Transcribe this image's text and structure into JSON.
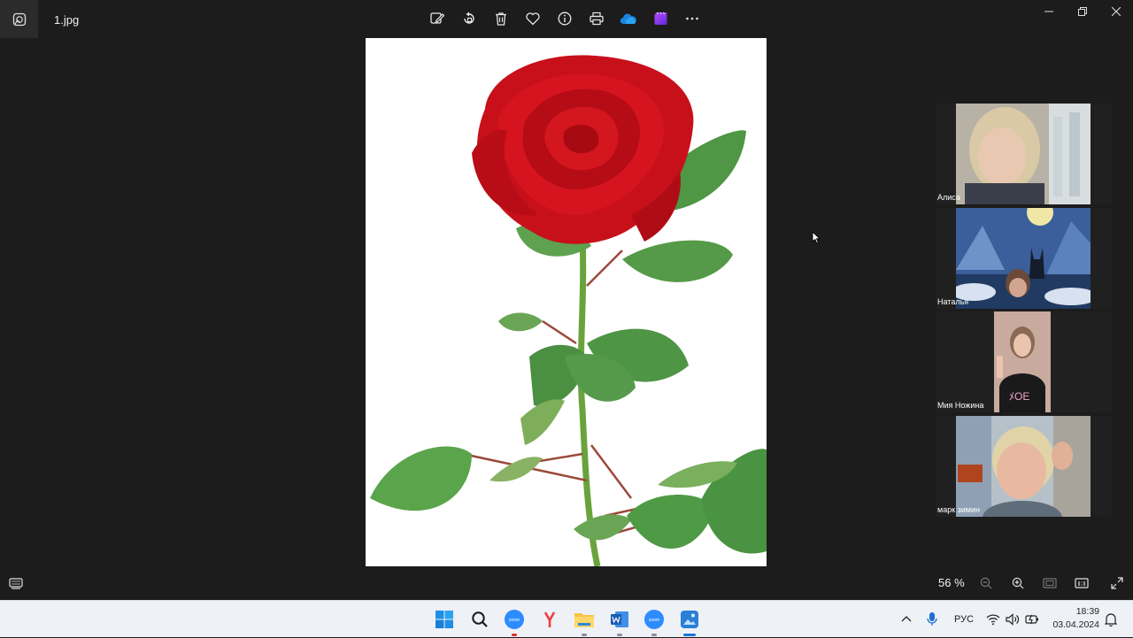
{
  "app": {
    "filename": "1.jpg",
    "zoom_level": "56 %"
  },
  "toolbar": {
    "items": [
      "edit-icon",
      "rotate-icon",
      "delete-icon",
      "favorite-icon",
      "info-icon",
      "print-icon",
      "onedrive-icon",
      "clipchamp-icon",
      "more-icon"
    ]
  },
  "participants": [
    {
      "name": "Алиса"
    },
    {
      "name": "Наталья"
    },
    {
      "name": "Мия Ножина"
    },
    {
      "name": "марк зимин"
    }
  ],
  "taskbar": {
    "language": "РУС",
    "time": "18:39",
    "date": "03.04.2024"
  },
  "colors": {
    "background": "#1c1c1c",
    "rose": "#c8101a",
    "leaf": "#4a9a48",
    "taskbar": "#eef1f6"
  }
}
